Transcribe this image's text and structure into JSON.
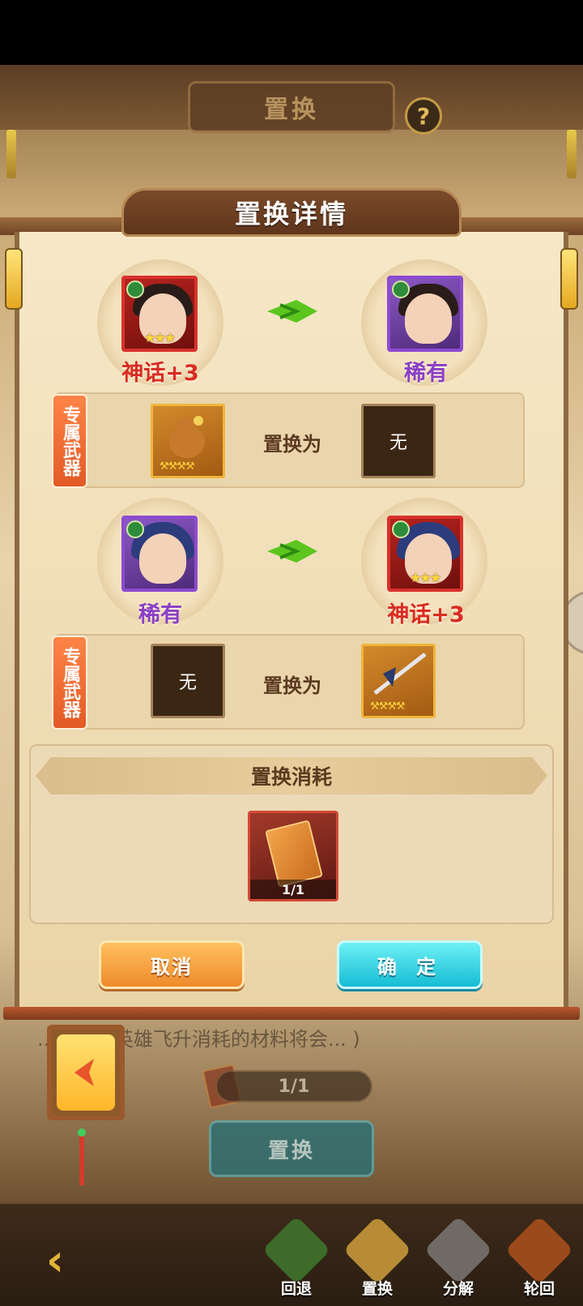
{
  "header": {
    "title": "置换",
    "help": "?"
  },
  "dialog": {
    "title": "置换详情",
    "pair1": {
      "from_rank": "神话+3",
      "to_rank": "稀有",
      "from_stars": "★★★",
      "weapon_tag": "专属武器",
      "weapon_from_stars": "⚒⚒⚒⚒",
      "swap_label": "置换为",
      "weapon_to": "无"
    },
    "pair2": {
      "from_rank": "稀有",
      "to_rank": "神话+3",
      "to_stars": "★★★",
      "weapon_tag": "专属武器",
      "weapon_from": "无",
      "swap_label": "置换为",
      "weapon_to_stars": "⚒⚒⚒⚒"
    },
    "cost": {
      "title": "置换消耗",
      "count": "1/1"
    },
    "cancel": "取消",
    "confirm": "确 定"
  },
  "background": {
    "hint": "...升级、英雄飞升消耗的材料将会... )",
    "progress": "1/1",
    "swap_button": "置换"
  },
  "nav": {
    "back": "‹",
    "items": [
      {
        "label": "回退",
        "color": "#2f8a2c"
      },
      {
        "label": "置换",
        "color": "#c79b3b"
      },
      {
        "label": "分解",
        "color": "#8a8d96"
      },
      {
        "label": "轮回",
        "color": "#b5561f"
      }
    ]
  }
}
